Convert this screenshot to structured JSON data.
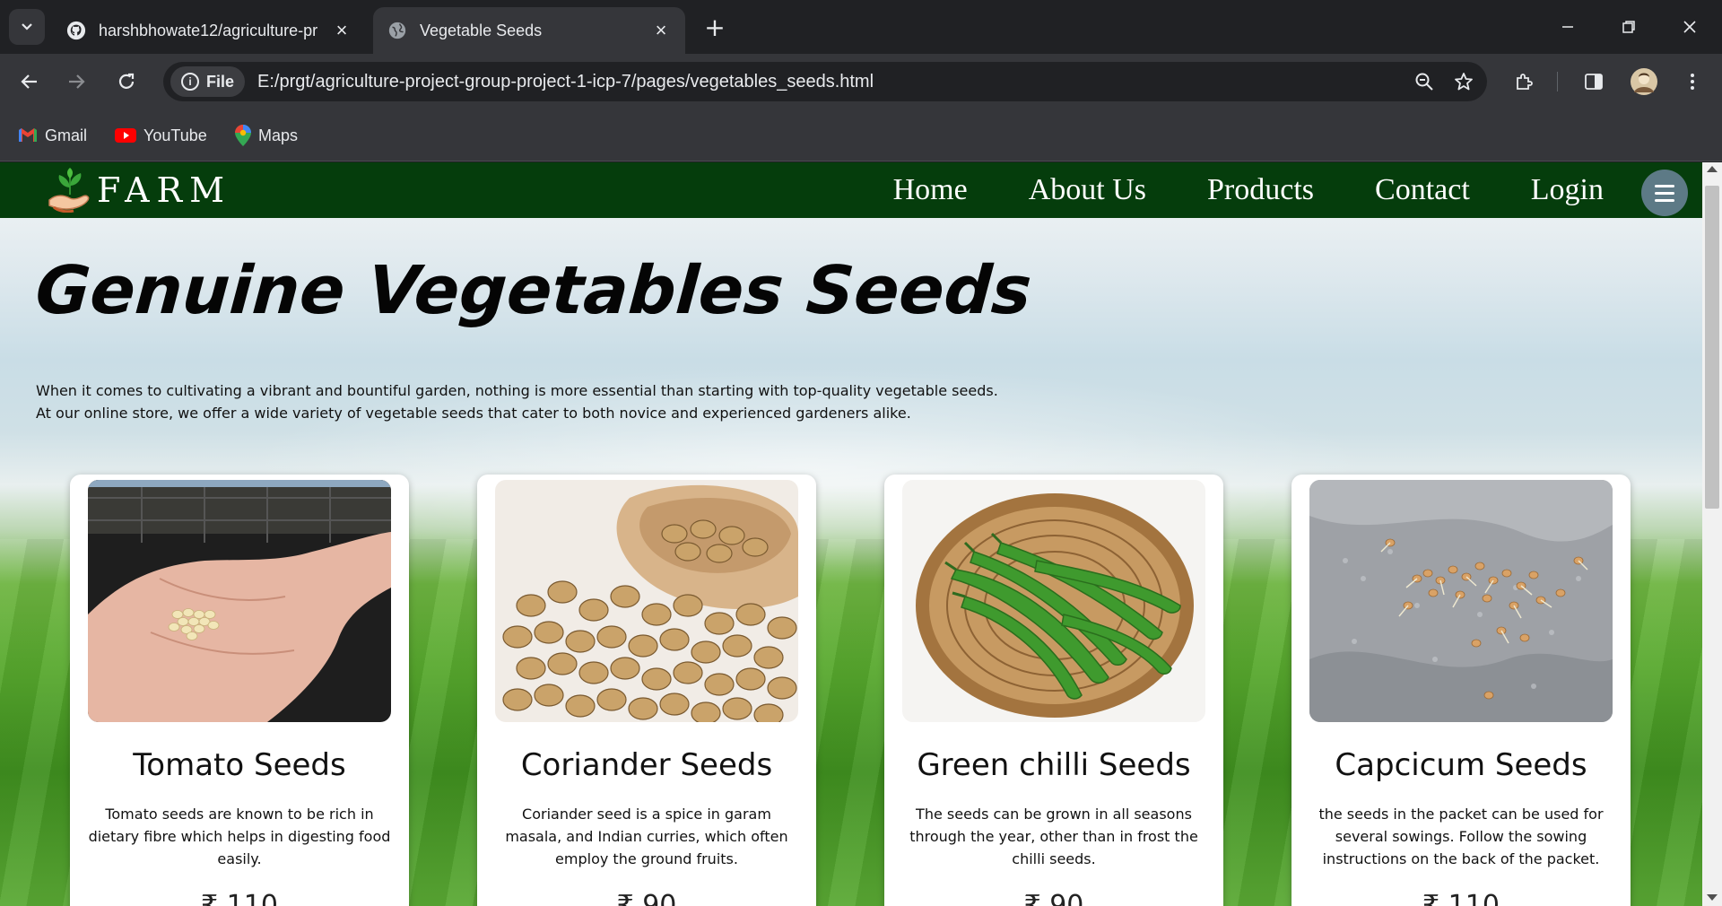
{
  "browser": {
    "tabs": [
      {
        "title": "harshbhowate12/agriculture-pr",
        "icon": "github-icon",
        "active": false
      },
      {
        "title": "Vegetable Seeds",
        "icon": "globe-icon",
        "active": true
      }
    ],
    "url_chip": "File",
    "url": "E:/prgt/agriculture-project-group-project-1-icp-7/pages/vegetables_seeds.html",
    "bookmarks": [
      {
        "label": "Gmail",
        "icon": "gmail-icon"
      },
      {
        "label": "YouTube",
        "icon": "youtube-icon"
      },
      {
        "label": "Maps",
        "icon": "maps-icon"
      }
    ]
  },
  "site": {
    "logo_text": "FARM",
    "nav": {
      "home": "Home",
      "about": "About Us",
      "products": "Products",
      "contact": "Contact",
      "login": "Login"
    },
    "title": "Genuine Vegetables Seeds",
    "intro_line1": "When it comes to cultivating a vibrant and bountiful garden, nothing is more essential than starting with top-quality vegetable seeds.",
    "intro_line2": "At our online store, we offer a wide variety of vegetable seeds that cater to both novice and experienced gardeners alike.",
    "cards": [
      {
        "title": "Tomato Seeds",
        "desc": "Tomato seeds are known to be rich in dietary fibre which helps in digesting food easily.",
        "price": "₹ 110",
        "image": "hand-with-tomato-seeds"
      },
      {
        "title": "Coriander Seeds",
        "desc": "Coriander seed is a spice in garam masala, and Indian curries, which often employ the ground fruits.",
        "price": "₹ 90",
        "image": "coriander-seeds-in-bowl"
      },
      {
        "title": "Green chilli Seeds",
        "desc": "The seeds can be grown in all seasons through the year, other than in frost the chilli seeds.",
        "price": "₹ 90",
        "image": "green-chillies-in-basket"
      },
      {
        "title": "Capcicum Seeds",
        "desc": "the seeds in the packet can be used for several sowings. Follow the sowing instructions on the back of the packet.",
        "price": "₹ 110",
        "image": "sprouting-capsicum-seeds"
      }
    ]
  },
  "colors": {
    "nav_bg": "#053d0c",
    "chrome_dark": "#202124",
    "chrome_mid": "#35363a"
  }
}
